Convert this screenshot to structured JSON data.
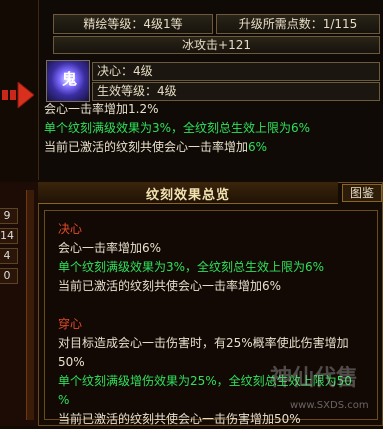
{
  "top": {
    "grade": "精绘等级：4级1等",
    "need_points": "升级所需点数：1/115",
    "skill": "冰攻击+121",
    "gem_glyph": "鬼",
    "juexin": "决心：4级",
    "shengxiao": "生效等级：4级",
    "desc": [
      {
        "text": "会心一击率增加1.2%",
        "color": "white"
      },
      {
        "text": "单个纹刻满级效果为3%，全纹刻总生效上限为6%",
        "color": "green"
      },
      {
        "text": "当前已激活的纹刻共使会心一击率增加6%",
        "color": "white_mixed",
        "main": "当前已激活的纹刻共使会心一击率增加",
        "value": "6%"
      }
    ]
  },
  "left_numbers": [
    "9",
    "14",
    "4",
    "0"
  ],
  "bottom": {
    "title": "纹刻效果总览",
    "tujian": "图鉴",
    "lines": [
      {
        "text": "决心",
        "color": "red"
      },
      {
        "text": "会心一击率增加6%",
        "color": "white"
      },
      {
        "text": "单个纹刻满级效果为3%，全纹刻总生效上限为6%",
        "color": "green"
      },
      {
        "text": "当前已激活的纹刻共使会心一击率增加6%",
        "color": "white"
      },
      {
        "text": "",
        "color": "white"
      },
      {
        "text": "穿心",
        "color": "red"
      },
      {
        "text": "对目标造成会心一击伤害时，有25%概率使此伤害增加",
        "color": "white"
      },
      {
        "text": "50%",
        "color": "white"
      },
      {
        "text": "单个纹刻满级增伤效果为25%，全纹刻总生效上限为50",
        "color": "green"
      },
      {
        "text": "%",
        "color": "green"
      },
      {
        "text": "当前已激活的纹刻共使会心一击伤害增加50%",
        "color": "white"
      }
    ]
  },
  "watermark": {
    "text": "神仙代售",
    "url": "www.SXDS.com"
  }
}
